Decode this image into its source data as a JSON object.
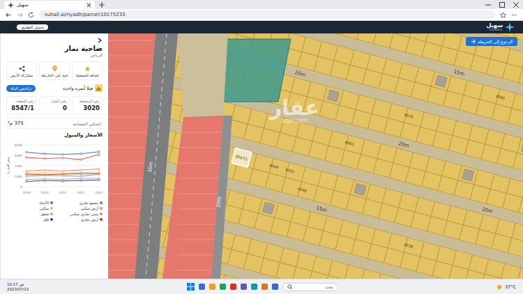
{
  "browser": {
    "tab": {
      "title": "سهيل",
      "selected": true
    },
    "url": "suhail.ai/riyadh/parcel/10175233"
  },
  "header": {
    "logo_ar": "سهيل",
    "logo_en": "SUHAIL",
    "download": "تحميل التطبيق"
  },
  "panel": {
    "title": "ضاحية نمار",
    "city": "الرياض",
    "actions": [
      {
        "label": "إضافة للمفضلة"
      },
      {
        "label": "فتح على الخارطة"
      },
      {
        "label": "مشاركة الأرض"
      }
    ],
    "usage": "فيلا أسرة واحدة",
    "permit_button": "تراخيص البناء",
    "stats": [
      {
        "label": "رقم المخطط",
        "value": "3020"
      },
      {
        "label": "رقم البلوك",
        "value": "0"
      },
      {
        "label": "رقم القطعة",
        "value": "8547/1"
      }
    ],
    "total_label": "إجمالي المساحة",
    "total_value": "375 م²"
  },
  "chart": {
    "title": "الأسعار والميول",
    "y_title": "سعر المتر م²",
    "y_ticks": [
      "0",
      "1000",
      "2000",
      "3000",
      "4000"
    ],
    "x_labels": [
      "2019",
      "2020",
      "2021",
      "2022",
      "2023"
    ],
    "series": [
      {
        "name": "مجمع تجاري",
        "color": "#e0533f",
        "values": [
          2800,
          2700,
          2750,
          2600,
          3100
        ]
      },
      {
        "name": "الأحياء",
        "color": "#3f6fd8",
        "values": [
          3300,
          3150,
          3100,
          3150,
          3350
        ]
      },
      {
        "name": "أرض سكني",
        "color": "#f08a6a",
        "values": [
          1500,
          1600,
          1500,
          1600,
          1700
        ]
      },
      {
        "name": "سكني",
        "color": "#f2c14e",
        "values": [
          1300,
          1350,
          1300,
          1350,
          1400
        ]
      },
      {
        "name": "مبنى تجاري سكني",
        "color": "#9a9a9a",
        "values": [
          1000,
          1100,
          1050,
          1000,
          1200
        ]
      },
      {
        "name": "شقق",
        "color": "#8ab0e8",
        "values": [
          700,
          750,
          700,
          800,
          800
        ]
      },
      {
        "name": "أرض تجاري",
        "color": "#c0392b",
        "values": [
          1200,
          1150,
          1200,
          1250,
          1250
        ]
      },
      {
        "name": "فلل",
        "color": "#7d2a4a",
        "values": [
          500,
          600,
          550,
          600,
          650
        ]
      }
    ]
  },
  "map": {
    "back_button": "الرجوع إلى الخريطة",
    "watermark_ar": "عقار",
    "watermark_en": "aqar.com",
    "roads": [
      {
        "label": "30m"
      },
      {
        "label": "20m"
      },
      {
        "label": "20m"
      },
      {
        "label": "15m"
      },
      {
        "label": "20m"
      },
      {
        "label": "15m"
      },
      {
        "label": "20m"
      }
    ],
    "parcels": [
      {
        "label": "8547/1",
        "selected": true
      },
      {
        "label": "8549",
        "selected": false
      },
      {
        "label": "8551",
        "selected": false
      },
      {
        "label": "8546",
        "selected": false
      },
      {
        "label": "8562",
        "selected": false
      },
      {
        "label": "8575",
        "selected": false
      },
      {
        "label": "8528",
        "selected": false
      },
      {
        "label": "8590",
        "selected": false
      }
    ]
  },
  "taskbar": {
    "search": "بحث",
    "weather": "37°C",
    "time": "10:17 ص",
    "date": "2023/07/21"
  }
}
